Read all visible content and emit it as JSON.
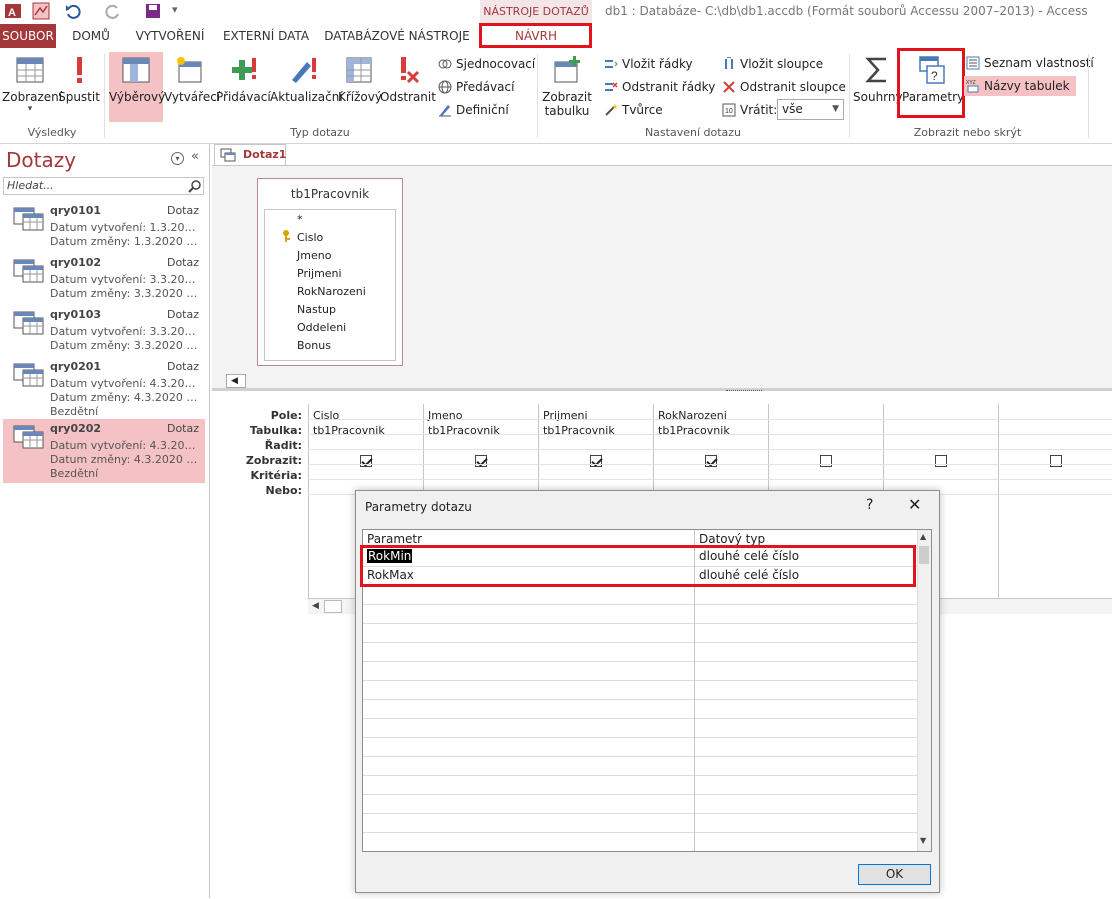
{
  "window": {
    "title": "db1 : Databáze- C:\\db\\db1.accdb (Formát souborů Accessu 2007–2013) - Access",
    "tools_tab": "NÁSTROJE DOTAZŮ"
  },
  "tabs": [
    "SOUBOR",
    "DOMŮ",
    "VYTVOŘENÍ",
    "EXTERNÍ DATA",
    "DATABÁZOVÉ NÁSTROJE",
    "NÁVRH"
  ],
  "ribbon": {
    "results": {
      "label": "Výsledky",
      "view": "Zobrazení",
      "run": "Spustit"
    },
    "query_type": {
      "label": "Typ dotazu",
      "select": "Výběrový",
      "make_table": "Vytvářecí",
      "append": "Přidávací",
      "update": "Aktualizační",
      "crosstab": "Křížový",
      "delete": "Odstranit",
      "union": "Sjednocovací",
      "pass_through": "Předávací",
      "definition": "Definiční"
    },
    "query_setup": {
      "label": "Nastavení dotazu",
      "show_table_1": "Zobrazit",
      "show_table_2": "tabulku",
      "insert_rows": "Vložit řádky",
      "delete_rows": "Odstranit řádky",
      "builder": "Tvůrce",
      "insert_cols": "Vložit sloupce",
      "delete_cols": "Odstranit sloupce",
      "return_label": "Vrátit:",
      "return_value": "vše"
    },
    "show_hide": {
      "label": "Zobrazit nebo skrýt",
      "totals": "Souhrny",
      "parameters": "Parametry",
      "property_sheet": "Seznam vlastností",
      "table_names": "Názvy tabulek"
    }
  },
  "nav": {
    "title": "Dotazy",
    "search_placeholder": "Hledat...",
    "items": [
      {
        "name": "qry0101",
        "type": "Dotaz",
        "created": "Datum vytvoření: 1.3.2020 2...",
        "modified": "Datum změny: 1.3.2020 22:...",
        "extra": ""
      },
      {
        "name": "qry0102",
        "type": "Dotaz",
        "created": "Datum vytvoření: 3.3.2020 1...",
        "modified": "Datum změny: 3.3.2020 10:...",
        "extra": ""
      },
      {
        "name": "qry0103",
        "type": "Dotaz",
        "created": "Datum vytvoření: 3.3.2020 1...",
        "modified": "Datum změny: 3.3.2020 10:...",
        "extra": ""
      },
      {
        "name": "qry0201",
        "type": "Dotaz",
        "created": "Datum vytvoření: 4.3.2020 7...",
        "modified": "Datum změny: 4.3.2020 9:5...",
        "extra": "Bezdětní"
      },
      {
        "name": "qry0202",
        "type": "Dotaz",
        "created": "Datum vytvoření: 4.3.2020 1...",
        "modified": "Datum změny: 4.3.2020 11:...",
        "extra": "Bezdětní"
      }
    ]
  },
  "document": {
    "tab": "Dotaz1",
    "table": {
      "name": "tb1Pracovnik",
      "fields": [
        "*",
        "Cislo",
        "Jmeno",
        "Prijmeni",
        "RokNarozeni",
        "Nastup",
        "Oddeleni",
        "Bonus"
      ]
    },
    "grid": {
      "row_labels": [
        "Pole:",
        "Tabulka:",
        "Řadit:",
        "Zobrazit:",
        "Kritéria:",
        "Nebo:"
      ],
      "columns": [
        {
          "field": "Cislo",
          "table": "tb1Pracovnik",
          "show": true
        },
        {
          "field": "Jmeno",
          "table": "tb1Pracovnik",
          "show": true
        },
        {
          "field": "Prijmeni",
          "table": "tb1Pracovnik",
          "show": true
        },
        {
          "field": "RokNarozeni",
          "table": "tb1Pracovnik",
          "show": true
        },
        {
          "field": "",
          "table": "",
          "show": false
        },
        {
          "field": "",
          "table": "",
          "show": false
        },
        {
          "field": "",
          "table": "",
          "show": false
        }
      ]
    }
  },
  "dialog": {
    "title": "Parametry dotazu",
    "help": "?",
    "close": "✕",
    "headers": {
      "param": "Parametr",
      "type": "Datový typ"
    },
    "rows": [
      {
        "param": "RokMin",
        "type": "dlouhé celé číslo"
      },
      {
        "param": "RokMax",
        "type": "dlouhé celé číslo"
      }
    ],
    "ok": "OK"
  },
  "colors": {
    "accent": "#a4373a",
    "highlight": "#f4c2c5",
    "annotation": "#e0141e"
  }
}
